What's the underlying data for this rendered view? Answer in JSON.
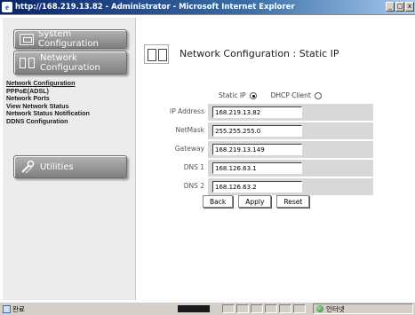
{
  "window": {
    "title": "http://168.219.13.82 - Administrator - Microsoft Internet Explorer",
    "min_label": "_",
    "max_label": "□",
    "close_label": "x"
  },
  "sidebar": {
    "system_config_label": "System Configuration",
    "network_config_label": "Network Configuration",
    "utilities_label": "Utilities",
    "links": [
      {
        "label": "Network Configuration",
        "active": true
      },
      {
        "label": "PPPoE(ADSL)",
        "active": false
      },
      {
        "label": "Network Ports",
        "active": false
      },
      {
        "label": "View Network Status",
        "active": false
      },
      {
        "label": "Network Status Notification",
        "active": false
      },
      {
        "label": "DDNS Configuration",
        "active": false
      }
    ]
  },
  "main": {
    "title": "Network Configuration : Static IP",
    "mode": {
      "static_label": "Static IP",
      "dhcp_label": "DHCP Client",
      "selected": "static"
    },
    "fields": [
      {
        "label": "IP Address",
        "value": "168.219.13.82"
      },
      {
        "label": "NetMask",
        "value": "255.255.255.0"
      },
      {
        "label": "Gateway",
        "value": "168.219.13.149"
      },
      {
        "label": "DNS 1",
        "value": "168.126.63.1"
      },
      {
        "label": "DNS 2",
        "value": "168.126.63.2"
      }
    ],
    "buttons": {
      "back": "Back",
      "apply": "Apply",
      "reset": "Reset"
    }
  },
  "status_bar": {
    "status_text": "완료",
    "zone_text": "인터넷"
  }
}
